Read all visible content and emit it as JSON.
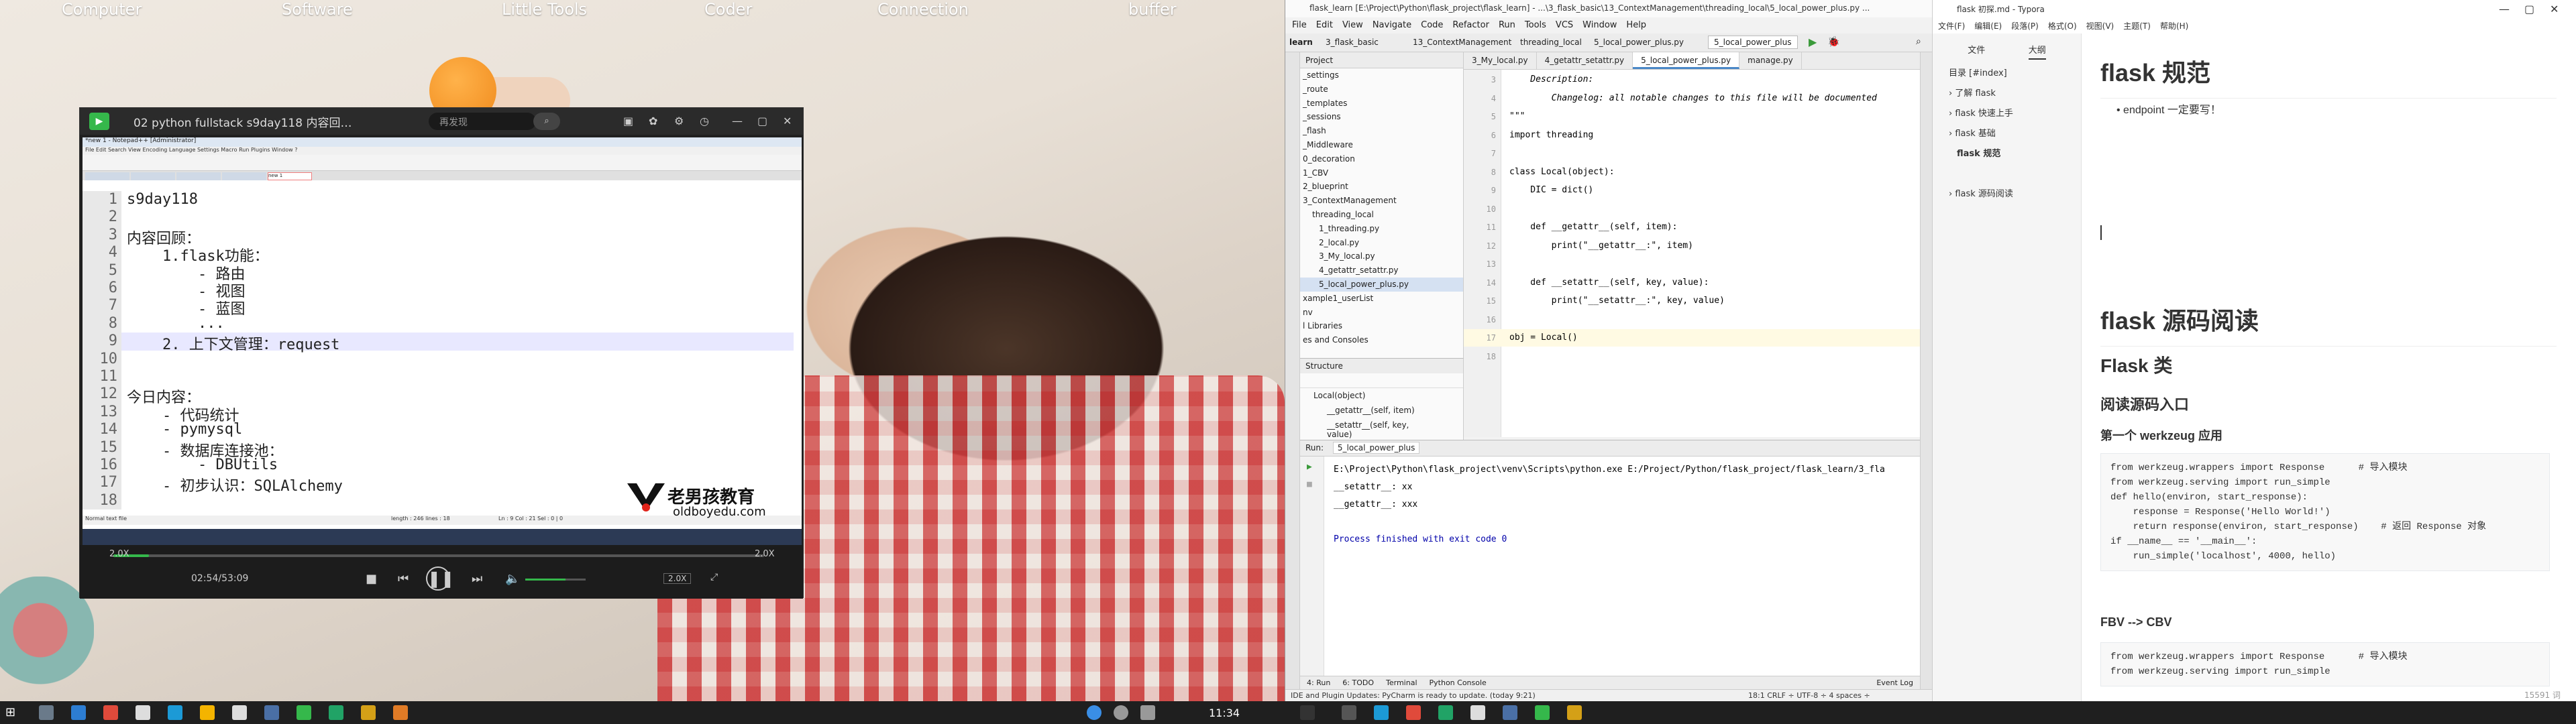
{
  "desktop": {
    "top_links": [
      "Computer",
      "Software",
      "Little Tools",
      "Coder",
      "Connection",
      "buffer"
    ]
  },
  "video": {
    "title": "02 python fullstack s9day118 内容回…",
    "search_placeholder": "再发现",
    "speed": "2.0X",
    "speed2": "2.0X",
    "time": "02:54/53:09",
    "progress": 0.055,
    "notepad": {
      "title": "*new 1 - Notepad++ [Administrator]",
      "lines": [
        "s9day118",
        "",
        "内容回顾：",
        "    1.flask功能：",
        "        - 路由",
        "        - 视图",
        "        - 蓝图",
        "        ...",
        "    2. 上下文管理：request",
        "",
        "",
        "今日内容：",
        "    - 代码统计",
        "    - pymysql",
        "    - 数据库连接池：",
        "        - DBUtils",
        "    - 初步认识：SQLAlchemy",
        ""
      ],
      "status_left": "Normal text file",
      "status_mid": "length : 246    lines : 18",
      "status_pos": "Ln : 9    Col : 21    Sel : 0 | 0"
    },
    "watermark": "老男孩教育",
    "watermark_url": "oldboyedu.com"
  },
  "pycharm": {
    "title": "flask_learn [E:\\Project\\Python\\flask_project\\flask_learn] - ...\\3_flask_basic\\13_ContextManagement\\threading_local\\5_local_power_plus.py ...",
    "menu": [
      "File",
      "Edit",
      "View",
      "Navigate",
      "Code",
      "Refactor",
      "Run",
      "Tools",
      "VCS",
      "Window",
      "Help"
    ],
    "breadcrumbs": [
      "learn",
      "3_flask_basic",
      "13_ContextManagement",
      "threading_local",
      "5_local_power_plus.py"
    ],
    "run_config": "5_local_power_plus",
    "project_label": "Project",
    "tree": [
      "_settings",
      "_route",
      "_templates",
      "_sessions",
      "_flash",
      "_Middleware",
      "0_decoration",
      "1_CBV",
      "2_blueprint",
      "3_ContextManagement",
      "threading_local",
      "1_threading.py",
      "2_local.py",
      "3_My_local.py",
      "4_getattr_setattr.py",
      "5_local_power_plus.py",
      "xample1_userList",
      "nv",
      "l Libraries",
      "es and Consoles"
    ],
    "structure_label": "Structure",
    "structure_items": [
      "Local(object)",
      "__getattr__(self, item)",
      "__setattr__(self, key, value)"
    ],
    "tabs": [
      "3_My_local.py",
      "4_getattr_setattr.py",
      "5_local_power_plus.py",
      "manage.py"
    ],
    "code": [
      {
        "n": "3",
        "t": "    Description:",
        "cls": "cm"
      },
      {
        "n": "4",
        "t": "        Changelog: all notable changes to this file will be documented",
        "cls": "cm"
      },
      {
        "n": "5",
        "t": "\"\"\"",
        "cls": "cm"
      },
      {
        "n": "6",
        "t": "import threading",
        "cls": ""
      },
      {
        "n": "7",
        "t": "",
        "cls": ""
      },
      {
        "n": "8",
        "t": "class Local(object):",
        "cls": ""
      },
      {
        "n": "9",
        "t": "    DIC = dict()",
        "cls": ""
      },
      {
        "n": "10",
        "t": "",
        "cls": ""
      },
      {
        "n": "11",
        "t": "    def __getattr__(self, item):",
        "cls": ""
      },
      {
        "n": "12",
        "t": "        print(\"__getattr__:\", item)",
        "cls": ""
      },
      {
        "n": "13",
        "t": "",
        "cls": ""
      },
      {
        "n": "14",
        "t": "    def __setattr__(self, key, value):",
        "cls": ""
      },
      {
        "n": "15",
        "t": "        print(\"__setattr__:\", key, value)",
        "cls": ""
      },
      {
        "n": "16",
        "t": "",
        "cls": ""
      },
      {
        "n": "17",
        "t": "obj = Local()",
        "cls": ""
      },
      {
        "n": "18",
        "t": "",
        "cls": ""
      }
    ],
    "run_label": "Run:",
    "run_tab": "5_local_power_plus",
    "run_output": [
      "E:\\Project\\Python\\flask_project\\venv\\Scripts\\python.exe E:/Project/Python/flask_project/flask_learn/3_fla",
      "__setattr__: xx",
      "__getattr__: xxx",
      "",
      "Process finished with exit code 0"
    ],
    "bottom_tabs": [
      "4: Run",
      "6: TODO",
      "Terminal",
      "Python Console",
      "Event Log"
    ],
    "status": "IDE and Plugin Updates: PyCharm is ready to update. (today 9:21)",
    "status_right": "18:1   CRLF ÷   UTF-8 ÷   4 spaces ÷"
  },
  "typora": {
    "title": "flask 初探.md - Typora",
    "menu": [
      "文件(F)",
      "编辑(E)",
      "段落(P)",
      "格式(O)",
      "视图(V)",
      "主题(T)",
      "帮助(H)"
    ],
    "side_tabs": [
      "文件",
      "大纲"
    ],
    "toc": [
      "目录 [#index]",
      "了解 flask",
      "flask 快速上手",
      "flask 基础",
      "flask 规范",
      "",
      "flask 源码阅读"
    ],
    "h1": "flask 规范",
    "bullet": "endpoint 一定要写！",
    "h1b": "flask 源码阅读",
    "h2": "Flask 类",
    "h3": "阅读源码入口",
    "h4": "第一个 werkzeug 应用",
    "code1": [
      "from werkzeug.wrappers import Response      # 导入模块",
      "from werkzeug.serving import run_simple",
      "",
      "def hello(environ, start_response):",
      "    response = Response('Hello World!')",
      "    return response(environ, start_response)    # 返回 Response 对象",
      "",
      "if __name__ == '__main__':",
      "    run_simple('localhost', 4000, hello)"
    ],
    "h4b": "FBV --> CBV",
    "code2": [
      "from werkzeug.wrappers import Response      # 导入模块",
      "from werkzeug.serving import run_simple"
    ],
    "word_count": "15591 词"
  },
  "taskbar": {
    "time": "11:34"
  }
}
